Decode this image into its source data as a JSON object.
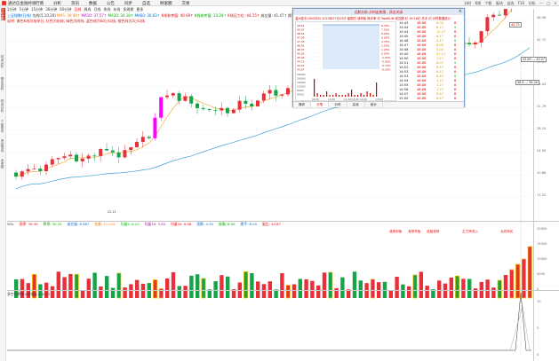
{
  "app": {
    "title": "通达信金融终端",
    "menu": [
      "行情",
      "分析",
      "资讯",
      "数据",
      "公告",
      "同步",
      "自选",
      "财富圈",
      "交易"
    ],
    "window_buttons": [
      "—",
      "□",
      "×"
    ],
    "right_tools": [
      "分时",
      "K线",
      "个股",
      "板块",
      "自选",
      "F10",
      "分析"
    ]
  },
  "period_bar": {
    "items": [
      "1分钟",
      "5分钟",
      "15分钟",
      "30分钟",
      "60分钟",
      "日线",
      "周线",
      "月线",
      "季线",
      "年线",
      "多周期",
      "更多"
    ],
    "active_index": 5
  },
  "info_line": {
    "stock": "上证指数(日线)",
    "ma_label": "均线(5,10,20)",
    "ma5": "MA5: 39.49↑",
    "ma10": "MA10: 37.57↑",
    "ma20": "MA20: 34.18↑",
    "ma60": "MA60: 30.63↑",
    "ref1": "K线参考值: 40.69↑",
    "ref2": "K线参考值: 33.28↑",
    "ref3": "K线压力位: 44.15↑",
    "extra": "成交量: 41.47↑  换手: 36.18↑  量比: 34.16↑  涨幅: 30.85↑"
  },
  "remark_line": "说明: 黄色K线为涨停日, 红色为阳线, 绿色为阴线, 蓝色线为60日均线, 橙色线为5日均线",
  "left_tabs": [
    "分时走势",
    "技术分析",
    "基本资料",
    "财务分析",
    "个股资讯",
    "资金流向",
    "龙虎榜"
  ],
  "price_axis": [
    "46.36",
    "42.72",
    "39.07",
    "35.43",
    "31.79",
    "28.15",
    "24.50",
    "20.86",
    "17.22"
  ],
  "vol_axis": [
    "20000",
    "15000",
    "10000",
    "5000",
    "0"
  ],
  "ind_axis": [
    "10",
    "5",
    "0"
  ],
  "chart_badges": {
    "high": "44.75",
    "mid": "43.89 — 43.47",
    "low": "38.8 — 36.26",
    "min_price": "22.11"
  },
  "vol_header": {
    "name": "VOL",
    "items": [
      {
        "text": "涨停: 39.39",
        "color": "#e00"
      },
      {
        "text": "跌停: 30.32",
        "color": "#0a0"
      },
      {
        "text": "成交量: 8.987",
        "color": "#06c"
      },
      {
        "text": "金额: 11.012",
        "color": "#e67e00"
      },
      {
        "text": "均量5: 8.10",
        "color": "#0a0"
      },
      {
        "text": "均量10: 3.00",
        "color": "#a0a"
      },
      {
        "text": "均量20: 6.98",
        "color": "#e00"
      },
      {
        "text": "涨跌: 4.30",
        "color": "#06c"
      },
      {
        "text": "振幅: 6.00",
        "color": "#0a0"
      },
      {
        "text": "换手: 8.00",
        "color": "#06c"
      },
      {
        "text": "量比: 44.87",
        "color": "#e00"
      }
    ]
  },
  "volume_events": [
    "涨停封板",
    "涨停开板",
    "连板涨停",
    "主力净流入",
    "北向净买"
  ],
  "ind_header": "多空分界线 K线指标 2.0017",
  "popup": {
    "title": "远航分析-分时走势图 - 双击关闭",
    "subtitle": "温州宏丰(300283) 2025年07月13日 星期日 涨停板 换手率 约 TopWLIN 成交额 约 16.16亿 总手 约 分时数据统计",
    "close": "×",
    "mini_axis_left": [
      "49.61",
      "49.07",
      "48.53",
      "47.99",
      "47.45",
      "46.91",
      "46.37",
      "45.83",
      "45.29",
      "44.75",
      "44.21",
      "43.67"
    ],
    "mini_axis_right": [
      "8.75%",
      "7.50%",
      "6.25%",
      "5.00%",
      "3.75%",
      "2.50%",
      "1.25%",
      "0.00%",
      "-1.25%",
      "-2.50%",
      "-3.75%",
      "-5.00%"
    ],
    "mini_vol_axis": [
      "26000",
      "20000",
      "16000",
      "12000",
      "8000",
      "4000"
    ],
    "mini_time_axis": [
      "09:30",
      "10:30",
      "11:30/13:00",
      "14:00",
      "15:00"
    ],
    "ticks": [
      {
        "time": "14:43",
        "price": "48.88",
        "vol": "6.00",
        "flag": "B"
      },
      {
        "time": "14:44",
        "price": "48.88",
        "vol": "8.17",
        "flag": "S"
      },
      {
        "time": "14:44",
        "price": "48.88",
        "vol": "12.27",
        "flag": "B"
      },
      {
        "time": "14:45",
        "price": "48.88",
        "vol": "6.17",
        "flag": "B"
      },
      {
        "time": "14:46",
        "price": "48.88",
        "vol": "4.47",
        "flag": "S"
      },
      {
        "time": "14:47",
        "price": "48.88",
        "vol": "8.00",
        "flag": "B"
      },
      {
        "time": "14:48",
        "price": "48.88",
        "vol": "3.00",
        "flag": "B"
      },
      {
        "time": "14:49",
        "price": "48.88",
        "vol": "51.17",
        "flag": "B"
      },
      {
        "time": "14:50",
        "price": "48.88",
        "vol": "1.27",
        "flag": "B"
      },
      {
        "time": "14:51",
        "price": "48.88",
        "vol": "6.07",
        "flag": "S"
      },
      {
        "time": "14:52",
        "price": "48.88",
        "vol": "8.47",
        "flag": "B"
      },
      {
        "time": "14:53",
        "price": "48.88",
        "vol": "8.47",
        "flag": "B"
      },
      {
        "time": "14:53",
        "price": "48.88",
        "vol": "8.67",
        "flag": "S"
      },
      {
        "time": "14:54",
        "price": "48.88",
        "vol": "1.27",
        "flag": "B"
      },
      {
        "time": "14:55",
        "price": "48.88",
        "vol": "1.27",
        "flag": "B"
      },
      {
        "time": "14:56",
        "price": "48.88",
        "vol": "1.27",
        "flag": "B"
      },
      {
        "time": "14:57",
        "price": "48.88",
        "vol": "8.47",
        "flag": "B"
      },
      {
        "time": "15:00",
        "price": "48.88",
        "vol": "8.47",
        "flag": "B"
      }
    ],
    "tabs": [
      "操作",
      "分笔",
      "分时",
      "买卖",
      "统计"
    ],
    "active_tab": 1
  },
  "colors": {
    "up": "#e8303a",
    "down": "#17a34a",
    "limit": "#f5c400",
    "magenta": "#ff00ff",
    "ma5": "#f39c12",
    "ma60": "#3ea0d8",
    "accent": "#e23a2e"
  }
}
